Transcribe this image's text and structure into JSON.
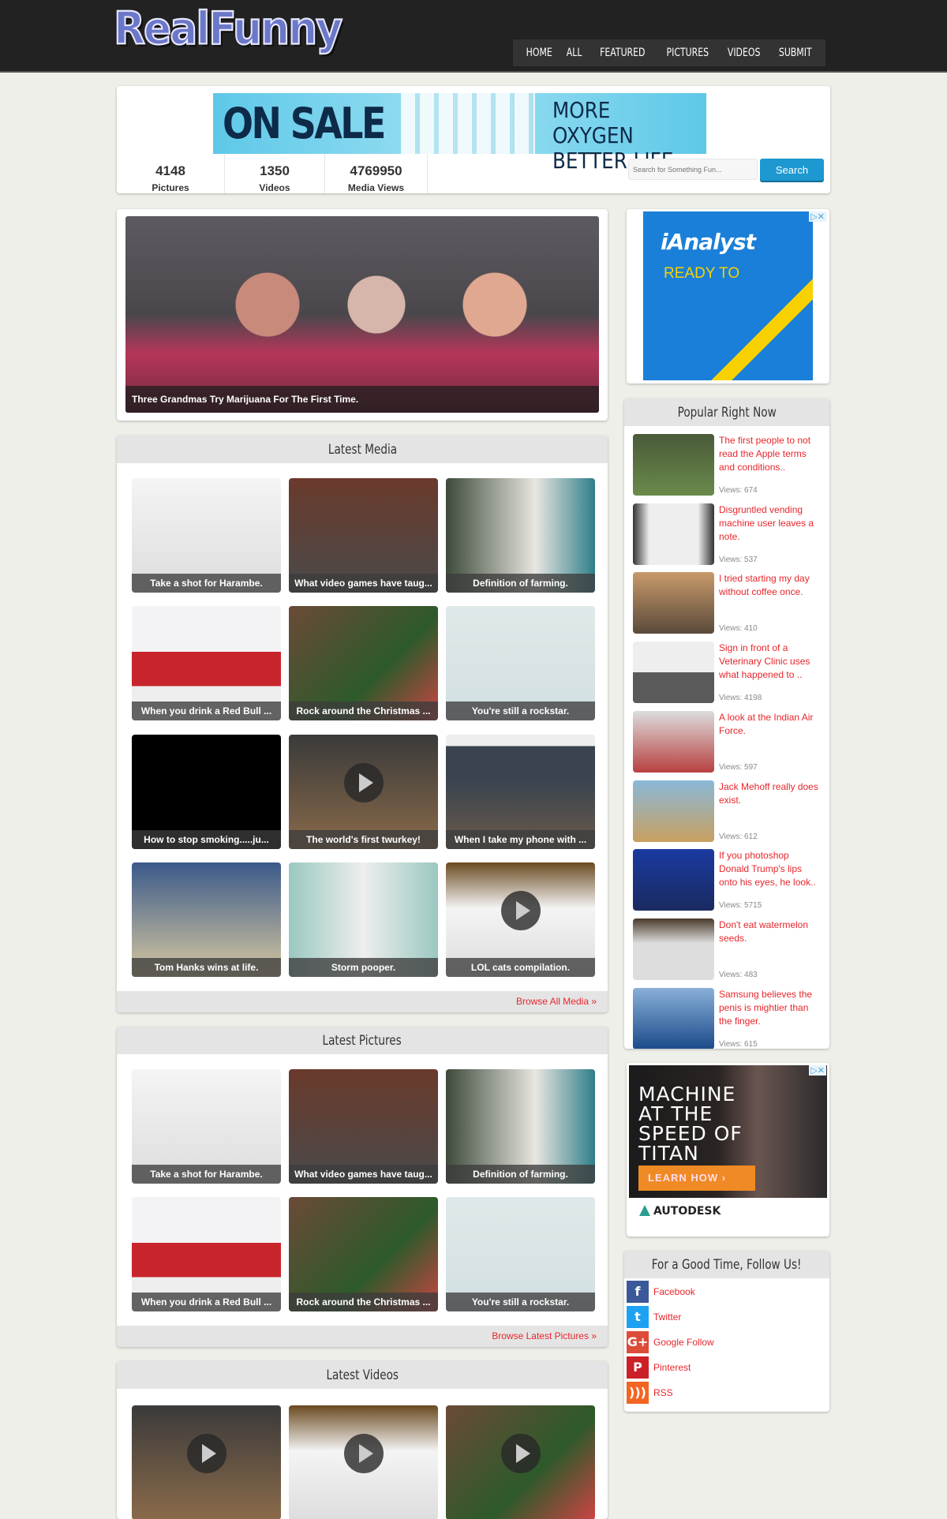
{
  "header": {
    "logo": "RealFunny",
    "nav": [
      "HOME",
      "ALL",
      "FEATURED",
      "PICTURES",
      "VIDEOS",
      "SUBMIT"
    ]
  },
  "top_banner_ad": {
    "headline": "ON SALE",
    "tagline_1": "MORE OXYGEN",
    "tagline_2": "BETTER LIFE"
  },
  "stats": [
    {
      "value": "4148",
      "label": "Pictures"
    },
    {
      "value": "1350",
      "label": "Videos"
    },
    {
      "value": "4769950",
      "label": "Media Views"
    }
  ],
  "search": {
    "placeholder": "Search for Something Fun...",
    "button": "Search"
  },
  "featured": {
    "caption": "Three Grandmas Try Marijuana For The First Time."
  },
  "side_ad_1": {
    "brand": "iAnalyst",
    "text": "READY TO"
  },
  "latest_media": {
    "title": "Latest Media",
    "footer_link": "Browse All Media »",
    "items": [
      {
        "caption": "Take a shot for Harambe.",
        "video": false
      },
      {
        "caption": "What video games have taug...",
        "video": false
      },
      {
        "caption": "Definition of farming.",
        "video": false
      },
      {
        "caption": "When you drink a Red Bull ...",
        "video": false
      },
      {
        "caption": "Rock around the Christmas ...",
        "video": false
      },
      {
        "caption": "You're still a rockstar.",
        "video": false
      },
      {
        "caption": "How to stop smoking.....ju...",
        "video": false
      },
      {
        "caption": "The world's first twurkey!",
        "video": true
      },
      {
        "caption": "When I take my phone with ...",
        "video": false
      },
      {
        "caption": "Tom Hanks wins at life.",
        "video": false
      },
      {
        "caption": "Storm pooper.",
        "video": false
      },
      {
        "caption": "LOL cats compilation.",
        "video": true
      }
    ]
  },
  "latest_pictures": {
    "title": "Latest Pictures",
    "footer_link": "Browse Latest Pictures »",
    "items": [
      {
        "caption": "Take a shot for Harambe."
      },
      {
        "caption": "What video games have taug..."
      },
      {
        "caption": "Definition of farming."
      },
      {
        "caption": "When you drink a Red Bull ..."
      },
      {
        "caption": "Rock around the Christmas ..."
      },
      {
        "caption": "You're still a rockstar."
      }
    ]
  },
  "latest_videos": {
    "title": "Latest Videos",
    "items": [
      {
        "video": true
      },
      {
        "video": true
      },
      {
        "video": true
      }
    ]
  },
  "popular": {
    "title": "Popular Right Now",
    "items": [
      {
        "title": "The first people to not read the Apple terms and conditions..",
        "views": "Views: 674"
      },
      {
        "title": "Disgruntled vending machine user leaves a note.",
        "views": "Views: 537"
      },
      {
        "title": "I tried starting my day without coffee once.",
        "views": "Views: 410"
      },
      {
        "title": "Sign in front of a Veterinary Clinic uses what happened to ..",
        "views": "Views: 4198"
      },
      {
        "title": "A look at the Indian Air Force.",
        "views": "Views: 597"
      },
      {
        "title": "Jack Mehoff really does exist.",
        "views": "Views: 612"
      },
      {
        "title": "If you photoshop Donald Trump's lips onto his eyes, he look..",
        "views": "Views: 5715"
      },
      {
        "title": "Don't eat watermelon seeds.",
        "views": "Views: 483"
      },
      {
        "title": "Samsung believes the penis is mightier than the finger.",
        "views": "Views: 615"
      }
    ]
  },
  "side_ad_2": {
    "headline": "MACHINE AT THE SPEED OF TITAN",
    "button": "LEARN HOW  ›",
    "brand": "AUTODESK"
  },
  "follow": {
    "title": "For a Good Time, Follow Us!",
    "links": [
      {
        "label": "Facebook",
        "icon": "facebook-icon",
        "glyph": "f",
        "color": "#3b5998"
      },
      {
        "label": "Twitter",
        "icon": "twitter-icon",
        "glyph": "t",
        "color": "#1da1f2"
      },
      {
        "label": "Google Follow",
        "icon": "google-plus-icon",
        "glyph": "G+",
        "color": "#dd4b39"
      },
      {
        "label": "Pinterest",
        "icon": "pinterest-icon",
        "glyph": "P",
        "color": "#cb2027"
      },
      {
        "label": "RSS",
        "icon": "rss-icon",
        "glyph": ")))",
        "color": "#f26522"
      }
    ]
  },
  "colors": {
    "link": "#e8262c",
    "header_bg": "#222222",
    "search_button": "#1e98d0"
  }
}
